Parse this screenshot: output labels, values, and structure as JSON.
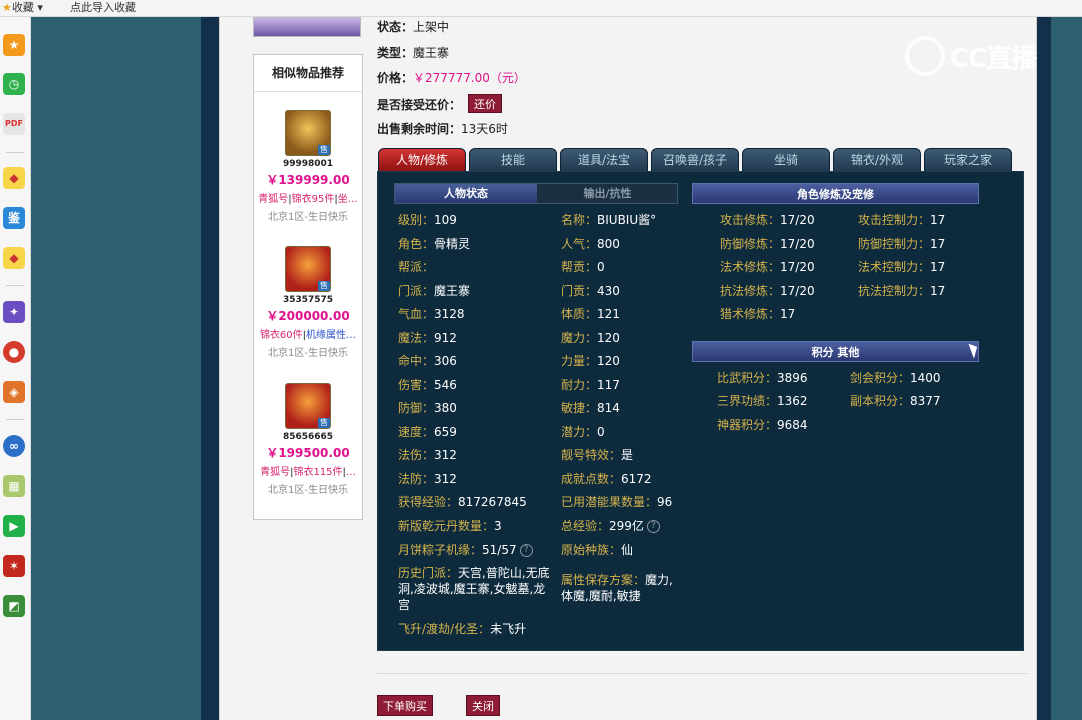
{
  "bookmark_bar": {
    "favorites": "收藏",
    "import": "点此导入收藏"
  },
  "watermark": {
    "text": "CC直播"
  },
  "similar": {
    "title": "相似物品推荐",
    "items": [
      {
        "id": "99998001",
        "price": "￥139999.00",
        "tag1": "青狐号",
        "tag2": "锦衣95件",
        "tag3": "坐…",
        "server": "北京1区-生日快乐",
        "sale": "售"
      },
      {
        "id": "35357575",
        "price": "￥200000.00",
        "tag1": "锦衣60件",
        "tag2": "",
        "tag3": "机缘属性…",
        "server": "北京1区-生日快乐",
        "sale": "售"
      },
      {
        "id": "85656665",
        "price": "￥199500.00",
        "tag1": "青狐号",
        "tag2": "锦衣115件",
        "tag3": "…",
        "server": "北京1区-生日快乐",
        "sale": "售"
      }
    ]
  },
  "info": {
    "status_label": "状态：",
    "status": "上架中",
    "type_label": "类型：",
    "type": "魔王寨",
    "price_label": "价格：",
    "price": "￥277777.00（元）",
    "counter_label": "是否接受还价：",
    "counter_btn": "还价",
    "time_label": "出售剩余时间：",
    "time": "13天6时"
  },
  "tabs": [
    "人物/修炼",
    "技能",
    "道具/法宝",
    "召唤兽/孩子",
    "坐骑",
    "锦衣/外观",
    "玩家之家"
  ],
  "subtabs": {
    "status": "人物状态",
    "output": "输出/抗性"
  },
  "sections": {
    "cultivation": "角色修炼及宠修",
    "points": "积分 其他"
  },
  "left_stats": [
    {
      "k": "级别：",
      "v": "109"
    },
    {
      "k": "角色：",
      "v": "骨精灵"
    },
    {
      "k": "帮派：",
      "v": ""
    },
    {
      "k": "门派：",
      "v": "魔王寨"
    },
    {
      "k": "气血：",
      "v": "3128"
    },
    {
      "k": "魔法：",
      "v": "912"
    },
    {
      "k": "命中：",
      "v": "306"
    },
    {
      "k": "伤害：",
      "v": "546"
    },
    {
      "k": "防御：",
      "v": "380"
    },
    {
      "k": "速度：",
      "v": "659"
    },
    {
      "k": "法伤：",
      "v": "312"
    },
    {
      "k": "法防：",
      "v": "312"
    },
    {
      "k": "获得经验：",
      "v": "817267845"
    },
    {
      "k": "新版乾元丹数量：",
      "v": "3"
    },
    {
      "k": "月饼粽子机缘：",
      "v": "51/57"
    }
  ],
  "mid_stats": [
    {
      "k": "名称：",
      "v": "BIUBIU酱°"
    },
    {
      "k": "人气：",
      "v": "800"
    },
    {
      "k": "帮贡：",
      "v": "0"
    },
    {
      "k": "门贡：",
      "v": "430"
    },
    {
      "k": "体质：",
      "v": "121"
    },
    {
      "k": "魔力：",
      "v": "120"
    },
    {
      "k": "力量：",
      "v": "120"
    },
    {
      "k": "耐力：",
      "v": "117"
    },
    {
      "k": "敏捷：",
      "v": "814"
    },
    {
      "k": "潜力：",
      "v": "0"
    },
    {
      "k": "靓号特效：",
      "v": "是"
    },
    {
      "k": "成就点数：",
      "v": "6172"
    },
    {
      "k": "已用潜能果数量：",
      "v": "96"
    },
    {
      "k": "总经验：",
      "v": "299亿"
    },
    {
      "k": "原始种族：",
      "v": "仙"
    }
  ],
  "history": {
    "k": "历史门派：",
    "v": "天宫,普陀山,无底洞,凌波城,魔王寨,女魃墓,龙宫"
  },
  "save_plan": {
    "k": "属性保存方案：",
    "v": "魔力,体魔,魔耐,敏捷"
  },
  "ascension": {
    "k": "飞升/渡劫/化圣：",
    "v": "未飞升"
  },
  "cultivation": [
    {
      "k": "攻击修炼：",
      "v": "17/20",
      "k2": "攻击控制力：",
      "v2": "17"
    },
    {
      "k": "防御修炼：",
      "v": "17/20",
      "k2": "防御控制力：",
      "v2": "17"
    },
    {
      "k": "法术修炼：",
      "v": "17/20",
      "k2": "法术控制力：",
      "v2": "17"
    },
    {
      "k": "抗法修炼：",
      "v": "17/20",
      "k2": "抗法控制力：",
      "v2": "17"
    },
    {
      "k": "猎术修炼：",
      "v": "17",
      "k2": "",
      "v2": ""
    }
  ],
  "points": [
    {
      "k": "比武积分：",
      "v": "3896",
      "k2": "剑会积分：",
      "v2": "1400"
    },
    {
      "k": "三界功绩：",
      "v": "1362",
      "k2": "副本积分：",
      "v2": "8377"
    },
    {
      "k": "神器积分：",
      "v": "9684",
      "k2": "",
      "v2": ""
    }
  ],
  "buttons": {
    "buy": "下单购买",
    "close": "关闭"
  },
  "colors": {
    "accent": "#8e1c36",
    "price": "#e0108c",
    "key_text": "#d4b24a",
    "panel_bg": "#0e2b3e"
  }
}
